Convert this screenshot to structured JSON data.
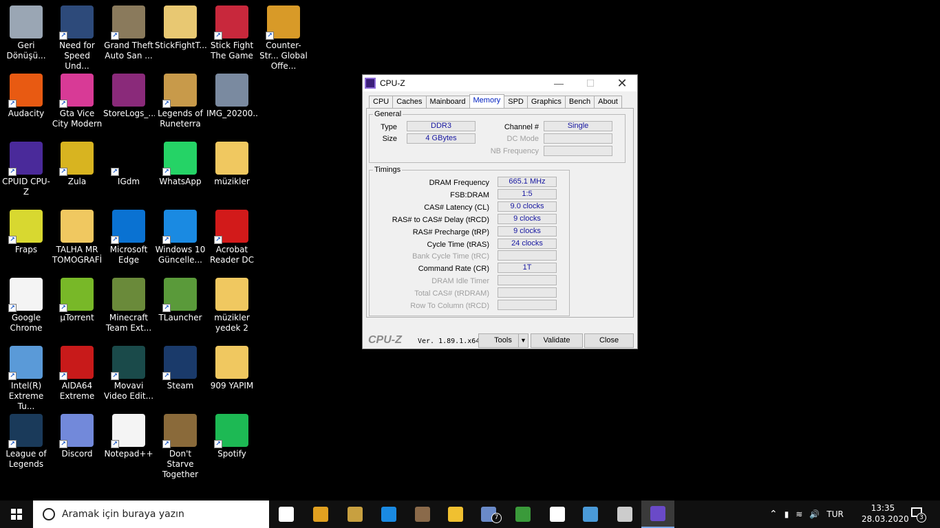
{
  "desktop": {
    "icons": [
      {
        "label": "Geri Dönüşü...",
        "icon": "recycle-bin-icon",
        "color": "#9aa6b4",
        "shortcut": false
      },
      {
        "label": "Need for Speed Und...",
        "icon": "nfs-icon",
        "color": "#2d4a7a",
        "shortcut": true
      },
      {
        "label": "Grand Theft Auto San ...",
        "icon": "gta-icon",
        "color": "#8a7a5c",
        "shortcut": true
      },
      {
        "label": "StickFightT...",
        "icon": "chrome-file-icon",
        "color": "#e8c872",
        "shortcut": false
      },
      {
        "label": "Stick Fight The Game",
        "icon": "stickfight-icon",
        "color": "#c8283c",
        "shortcut": true
      },
      {
        "label": "Counter-Str... Global Offe...",
        "icon": "csgo-icon",
        "color": "#d89a28",
        "shortcut": true
      },
      {
        "label": "Audacity",
        "icon": "audacity-icon",
        "color": "#e85a12",
        "shortcut": true
      },
      {
        "label": "Gta Vice City Modern",
        "icon": "vicecity-icon",
        "color": "#d83a96",
        "shortcut": true
      },
      {
        "label": "StoreLogs_...",
        "icon": "winrar-icon",
        "color": "#8a2a7a",
        "shortcut": false
      },
      {
        "label": "Legends of Runeterra",
        "icon": "runeterra-icon",
        "color": "#c89a4a",
        "shortcut": true
      },
      {
        "label": "IMG_20200...",
        "icon": "image-file-icon",
        "color": "#7a8aa0",
        "shortcut": false
      },
      {
        "label": "CPUID CPU-Z",
        "icon": "cpuz-icon",
        "color": "#4a2a9a",
        "shortcut": true
      },
      {
        "label": "Zula",
        "icon": "zula-icon",
        "color": "#d8b420",
        "shortcut": true
      },
      {
        "label": "IGdm",
        "icon": "igdm-icon",
        "color": "#000000",
        "shortcut": true
      },
      {
        "label": "WhatsApp",
        "icon": "whatsapp-icon",
        "color": "#25d366",
        "shortcut": true
      },
      {
        "label": "müzikler",
        "icon": "music-folder-icon",
        "color": "#f0c860",
        "shortcut": false
      },
      {
        "label": "Fraps",
        "icon": "fraps-icon",
        "color": "#d8d830",
        "shortcut": true
      },
      {
        "label": "TALHA MR TOMOGRAFİ",
        "icon": "folder-icon",
        "color": "#f0c860",
        "shortcut": false
      },
      {
        "label": "Microsoft Edge",
        "icon": "edge-icon",
        "color": "#0a72d2",
        "shortcut": true
      },
      {
        "label": "Windows 10 Güncelle...",
        "icon": "windows-update-icon",
        "color": "#1a8ae2",
        "shortcut": true
      },
      {
        "label": "Acrobat Reader DC",
        "icon": "acrobat-icon",
        "color": "#d21a1a",
        "shortcut": true
      },
      {
        "label": "Google Chrome",
        "icon": "blank-file-icon",
        "color": "#f4f4f4",
        "shortcut": true
      },
      {
        "label": "µTorrent",
        "icon": "utorrent-icon",
        "color": "#78b828",
        "shortcut": true
      },
      {
        "label": "Minecraft Team Ext...",
        "icon": "minecraft-icon",
        "color": "#6a8a3a",
        "shortcut": false
      },
      {
        "label": "TLauncher",
        "icon": "tlauncher-icon",
        "color": "#5a9a3a",
        "shortcut": true
      },
      {
        "label": "müzikler yedek 2",
        "icon": "music-folder-icon",
        "color": "#f0c860",
        "shortcut": false
      },
      {
        "label": "Intel(R) Extreme Tu...",
        "icon": "intel-xtu-icon",
        "color": "#5a9ad8",
        "shortcut": true
      },
      {
        "label": "AIDA64 Extreme",
        "icon": "aida64-icon",
        "color": "#c81a1a",
        "shortcut": true
      },
      {
        "label": "Movavi Video Edit...",
        "icon": "movavi-icon",
        "color": "#1a4a4a",
        "shortcut": true
      },
      {
        "label": "Steam",
        "icon": "steam-icon",
        "color": "#1a3a6a",
        "shortcut": true
      },
      {
        "label": "909 YAPIM",
        "icon": "music-folder-icon",
        "color": "#f0c860",
        "shortcut": false
      },
      {
        "label": "League of Legends",
        "icon": "lol-icon",
        "color": "#1a3a5a",
        "shortcut": true
      },
      {
        "label": "Discord",
        "icon": "discord-icon",
        "color": "#7289da",
        "shortcut": true
      },
      {
        "label": "Notepad++",
        "icon": "blank-file-icon",
        "color": "#f4f4f4",
        "shortcut": true
      },
      {
        "label": "Don't Starve Together",
        "icon": "dontstarve-icon",
        "color": "#8a6a3a",
        "shortcut": true
      },
      {
        "label": "Spotify",
        "icon": "spotify-icon",
        "color": "#1db954",
        "shortcut": true
      }
    ]
  },
  "cpuz": {
    "title": "CPU-Z",
    "tabs": [
      "CPU",
      "Caches",
      "Mainboard",
      "Memory",
      "SPD",
      "Graphics",
      "Bench",
      "About"
    ],
    "active_tab": "Memory",
    "general": {
      "legend": "General",
      "type_label": "Type",
      "type_value": "DDR3",
      "size_label": "Size",
      "size_value": "4 GBytes",
      "channel_label": "Channel #",
      "channel_value": "Single",
      "dcmode_label": "DC Mode",
      "dcmode_value": "",
      "nbfreq_label": "NB Frequency",
      "nbfreq_value": ""
    },
    "timings": {
      "legend": "Timings",
      "rows": [
        {
          "label": "DRAM Frequency",
          "value": "665.1 MHz",
          "enabled": true
        },
        {
          "label": "FSB:DRAM",
          "value": "1:5",
          "enabled": true
        },
        {
          "label": "CAS# Latency (CL)",
          "value": "9.0 clocks",
          "enabled": true
        },
        {
          "label": "RAS# to CAS# Delay (tRCD)",
          "value": "9 clocks",
          "enabled": true
        },
        {
          "label": "RAS# Precharge (tRP)",
          "value": "9 clocks",
          "enabled": true
        },
        {
          "label": "Cycle Time (tRAS)",
          "value": "24 clocks",
          "enabled": true
        },
        {
          "label": "Bank Cycle Time (tRC)",
          "value": "",
          "enabled": false
        },
        {
          "label": "Command Rate (CR)",
          "value": "1T",
          "enabled": true
        },
        {
          "label": "DRAM Idle Timer",
          "value": "",
          "enabled": false
        },
        {
          "label": "Total CAS# (tRDRAM)",
          "value": "",
          "enabled": false
        },
        {
          "label": "Row To Column (tRCD)",
          "value": "",
          "enabled": false
        }
      ]
    },
    "footer": {
      "logo": "CPU-Z",
      "version": "Ver. 1.89.1.x64",
      "tools": "Tools",
      "validate": "Validate",
      "close": "Close"
    }
  },
  "taskbar": {
    "search_placeholder": "Aramak için buraya yazın",
    "apps": [
      {
        "icon": "task-view-icon",
        "color": "#ffffff"
      },
      {
        "icon": "store-icon",
        "color": "#e0a020"
      },
      {
        "icon": "lol-taskbar-icon",
        "color": "#c8a040"
      },
      {
        "icon": "edge-taskbar-icon",
        "color": "#1a8ae2"
      },
      {
        "icon": "gta-taskbar-icon",
        "color": "#8a6a4a"
      },
      {
        "icon": "file-explorer-icon",
        "color": "#f0c030"
      },
      {
        "icon": "mail-icon",
        "color": "#6a8ac8"
      },
      {
        "icon": "chrome-taskbar-icon",
        "color": "#3a9a3a"
      },
      {
        "icon": "security-shield-icon",
        "color": "#ffffff"
      },
      {
        "icon": "network-app-icon",
        "color": "#4a9ad8"
      },
      {
        "icon": "terminal-icon",
        "color": "#cccccc"
      },
      {
        "icon": "cpuz-taskbar-icon",
        "color": "#6a4ac8"
      }
    ],
    "mail_badge": "7",
    "language": "TUR",
    "time": "13:35",
    "date": "28.03.2020",
    "notification_count": "3"
  }
}
